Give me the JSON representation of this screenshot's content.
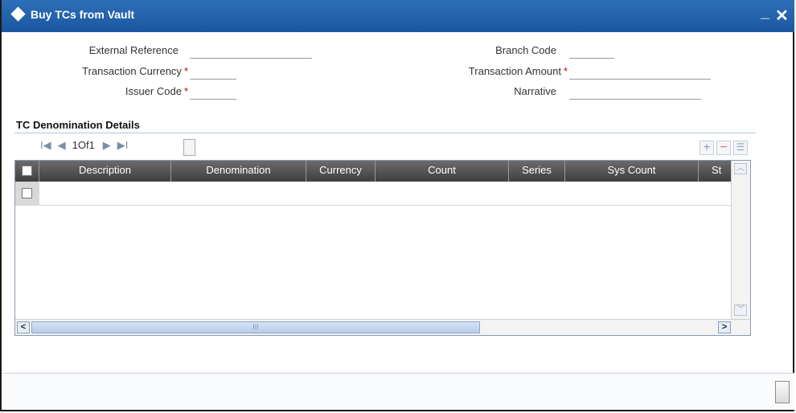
{
  "window": {
    "title": "Buy TCs from Vault",
    "minimize": "_",
    "close": "✕"
  },
  "form": {
    "external_reference_label": "External Reference",
    "external_reference_value": "",
    "transaction_currency_label": "Transaction Currency",
    "transaction_currency_value": "",
    "issuer_code_label": "Issuer Code",
    "issuer_code_value": "",
    "branch_code_label": "Branch Code",
    "branch_code_value": "",
    "transaction_amount_label": "Transaction Amount",
    "transaction_amount_value": "",
    "narrative_label": "Narrative",
    "narrative_value": "",
    "required_marker": "*"
  },
  "section": {
    "title": "TC Denomination Details"
  },
  "pager": {
    "first": "I◀",
    "prev": "◀",
    "text": "1Of1",
    "next": "▶",
    "last": "▶I"
  },
  "toolbar": {
    "add": "+",
    "remove": "−",
    "view": "☰"
  },
  "grid": {
    "columns": [
      "Description",
      "Denomination",
      "Currency",
      "Count",
      "Series",
      "Sys Count",
      "St"
    ],
    "rows": [
      {
        "selected": false
      }
    ]
  },
  "scroll": {
    "left": "<",
    "right": ">",
    "up": "︿",
    "down": "﹀",
    "thumb_grip": "III"
  },
  "colors": {
    "titlebar": "#1b56a0",
    "header": "#4a4a4a",
    "required": "#cc0000"
  }
}
